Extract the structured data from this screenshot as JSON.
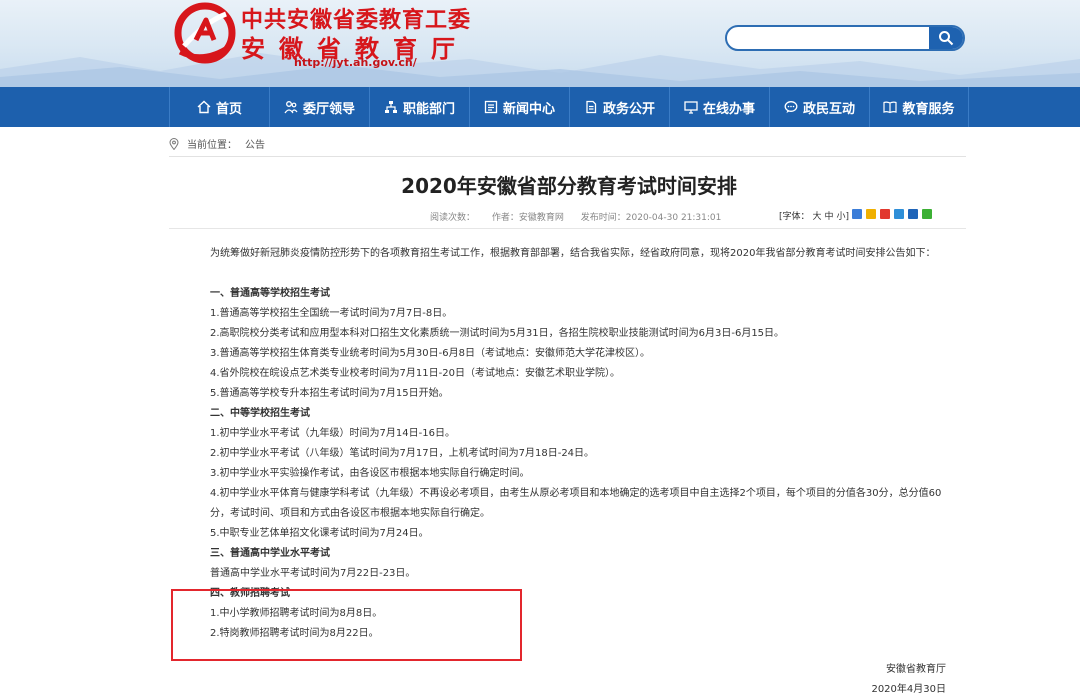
{
  "header": {
    "title_line1": "中共安徽省委教育工委",
    "title_line2": "安徽省教育厅",
    "url": "http://jyt.ah.gov.cn/",
    "search_placeholder": "",
    "brand_color": "#d7161b",
    "nav_color": "#1d60ad"
  },
  "nav": [
    {
      "label": "首页",
      "icon": "home-icon"
    },
    {
      "label": "委厅领导",
      "icon": "people-icon"
    },
    {
      "label": "职能部门",
      "icon": "sitemap-icon"
    },
    {
      "label": "新闻中心",
      "icon": "news-icon"
    },
    {
      "label": "政务公开",
      "icon": "document-icon"
    },
    {
      "label": "在线办事",
      "icon": "monitor-icon"
    },
    {
      "label": "政民互动",
      "icon": "chat-icon"
    },
    {
      "label": "教育服务",
      "icon": "book-icon"
    }
  ],
  "breadcrumb": {
    "prefix": "当前位置：",
    "current": "公告"
  },
  "article": {
    "title": "2020年安徽省部分教育考试时间安排",
    "views": "阅读次数：",
    "author": "作者：安徽教育网",
    "published": "发布时间：2020-04-30 21:31:01",
    "font_label": "[字体：",
    "font_large": "大",
    "font_medium": "中",
    "font_small": "小]",
    "paragraphs": [
      "为统筹做好新冠肺炎疫情防控形势下的各项教育招生考试工作，根据教育部部署，结合我省实际，经省政府同意，现将2020年我省部分教育考试时间安排公告如下：",
      "一、普通高等学校招生考试",
      "1.普通高等学校招生全国统一考试时间为7月7日-8日。",
      "2.高职院校分类考试和应用型本科对口招生文化素质统一测试时间为5月31日，各招生院校职业技能测试时间为6月3日-6月15日。",
      "3.普通高等学校招生体育类专业统考时间为5月30日-6月8日（考试地点：安徽师范大学花津校区）。",
      "4.省外院校在皖设点艺术类专业校考时间为7月11日-20日（考试地点：安徽艺术职业学院）。",
      "5.普通高等学校专升本招生考试时间为7月15日开始。",
      "二、中等学校招生考试",
      "1.初中学业水平考试（九年级）时间为7月14日-16日。",
      "2.初中学业水平考试（八年级）笔试时间为7月17日，上机考试时间为7月18日-24日。",
      "3.初中学业水平实验操作考试，由各设区市根据本地实际自行确定时间。",
      "4.初中学业水平体育与健康学科考试（九年级）不再设必考项目，由考生从原必考项目和本地确定的选考项目中自主选择2个项目，每个项目的分值各30分，总分值60分，考试时间、项目和方式由各设区市根据本地实际自行确定。",
      "5.中职专业艺体单招文化课考试时间为7月24日。",
      "三、普通高中学业水平考试",
      "普通高中学业水平考试时间为7月22日-23日。",
      "四、教师招聘考试",
      "1.中小学教师招聘考试时间为8月8日。",
      "2.特岗教师招聘考试时间为8月22日。"
    ],
    "signature": "安徽省教育厅",
    "date": "2020年4月30日"
  }
}
